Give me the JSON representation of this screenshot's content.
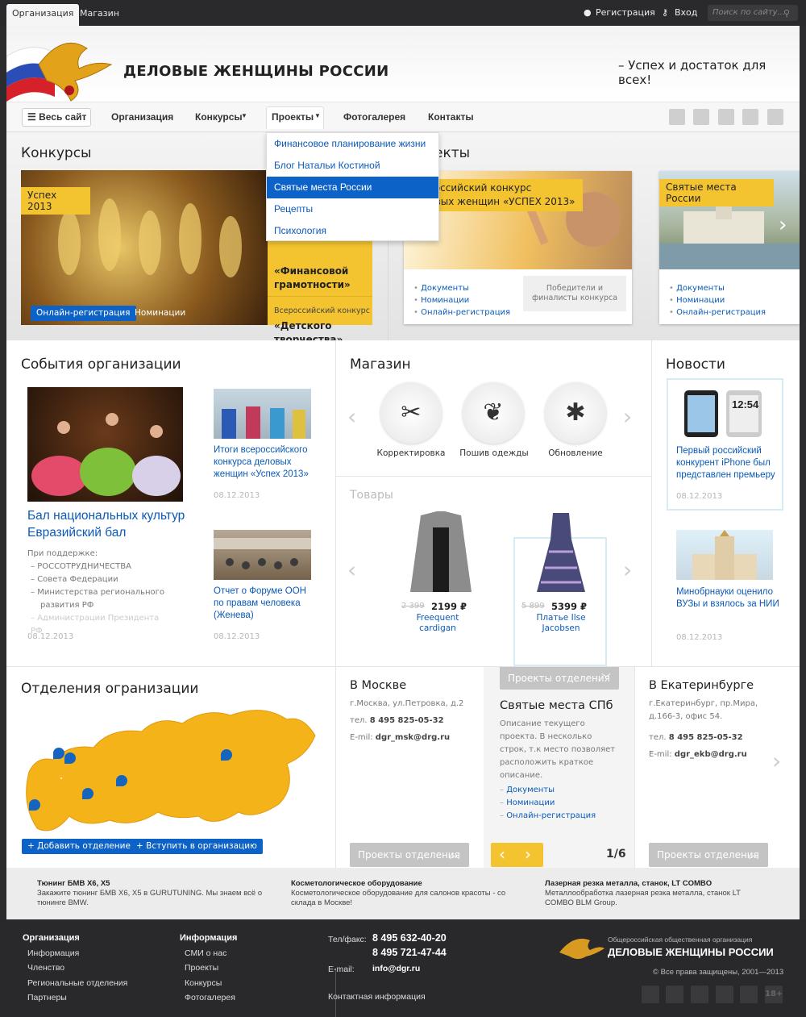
{
  "topbar": {
    "tabs": [
      "Организация",
      "Магазин"
    ],
    "register": "Регистрация",
    "login": "Вход",
    "search_placeholder": "Поиск по сайту..."
  },
  "header": {
    "title": "ДЕЛОВЫЕ ЖЕНЩИНЫ РОССИИ",
    "slogan": "– Успех и достаток для всех!"
  },
  "nav": {
    "all_site": "Весь сайт",
    "items": [
      "Организация",
      "Конкурсы",
      "Проекты",
      "Фотогалерея",
      "Контакты"
    ]
  },
  "dropdown": [
    "Финансовое планирование жизни",
    "Блог Натальи Костиной",
    "Святые места России",
    "Рецепты",
    "Психология"
  ],
  "competitions": {
    "heading": "Конкурсы",
    "heading2": "екты",
    "feature": {
      "label": "Успех 2013",
      "register_btn": "Онлайн-регистрация",
      "nominations": "Номинации"
    },
    "side": [
      {
        "title": "«Финансовой грамотности»"
      },
      {
        "pre": "Всероссийский конкурс",
        "title": "«Детского творчества»"
      }
    ],
    "project1": {
      "label": "Всероссийский конкурс деловых женщин «УСПЕХ 2013»",
      "links": [
        "Документы",
        "Номинации",
        "Онлайн-регистрация"
      ],
      "winners": "Победители и финалисты конкурса"
    },
    "project2": {
      "label": "Святые места России",
      "links": [
        "Документы",
        "Номинации",
        "Онлайн-регистрация"
      ]
    }
  },
  "events": {
    "heading": "События организации",
    "main_title": "Бал национальных культур Евразийский бал",
    "support_label": "При поддержке:",
    "support": [
      "РОССОТРУДНИЧЕСТВА",
      "Совета Федерации",
      "Министерства регионального развития РФ",
      "Администрации Президента РФ"
    ],
    "main_date": "08.12.2013",
    "items": [
      {
        "title": "Итоги всероссийского конкурса деловых женщин «Успех 2013»",
        "date": "08.12.2013"
      },
      {
        "title": "Отчет о Форуме ООН по правам человека (Женева)",
        "date": "08.12.2013"
      }
    ]
  },
  "shop": {
    "heading": "Магазин",
    "services": [
      {
        "icon": "scissors-icon",
        "label": "Корректировка"
      },
      {
        "icon": "leaf-icon",
        "label": "Пошив одежды"
      },
      {
        "icon": "asterisk-icon",
        "label": "Обновление"
      }
    ],
    "goods_heading": "Товары",
    "goods": [
      {
        "old": "2 399",
        "price": "2199 ₽",
        "name": "Freequent cardigan"
      },
      {
        "old": "5 899",
        "price": "5399 ₽",
        "name": "Платье Ilse Jacobsen"
      }
    ]
  },
  "news": {
    "heading": "Новости",
    "items": [
      {
        "title": "Первый российский конкурент iPhone был представлен премьеру",
        "date": "08.12.2013",
        "phone_time": "12:54"
      },
      {
        "title": "Минобрнауки оценило ВУЗы и взялось за НИИ",
        "date": "08.12.2013"
      }
    ]
  },
  "branches": {
    "heading": "Отделения огранизации",
    "add_btn": "Добавить отделение",
    "join_btn": "Вступить в организацию",
    "moscow": {
      "title": "В Москве",
      "address": "г.Москва, ул.Петровка, д.2",
      "phone_label": "тел.",
      "phone": "8 495 825-05-32",
      "email_label": "E-mil:",
      "email": "dgr_msk@drg.ru",
      "btn": "Проекты отделения"
    },
    "spb": {
      "tab": "Проекты отделения",
      "title": "Святые места СПб",
      "desc": "Описание текущего проекта. В несколько строк, т.к место позволяет расположить краткое описание.",
      "links": [
        "Документы",
        "Номинации",
        "Онлайн-регистрация"
      ],
      "pager": "1/6"
    },
    "ekb": {
      "title": "В Екатеринбурге",
      "address": "г.Екатеринбург, пр.Мира, д.166-3, офис 54.",
      "phone_label": "тел.",
      "phone": "8 495 825-05-32",
      "email_label": "E-mil:",
      "email": "dgr_ekb@drg.ru",
      "btn": "Проекты отделения"
    }
  },
  "ads": [
    {
      "title": "Тюнинг БМВ X6, X5",
      "text": "Закажите тюнинг БМВ X6, X5 в GURUTUNING. Мы знаем всё о тюнинге BMW."
    },
    {
      "title": "Косметологическое оборудование",
      "text": "Косметологическое оборудование для салонов красоты - со склада в Москве!"
    },
    {
      "title": "Лазерная резка металла, станок, LT COMBO",
      "text": "Металлообработка лазерная резка металла, станок LT COMBO BLM Group."
    }
  ],
  "footer": {
    "col1": {
      "heading": "Организация",
      "links": [
        "Информация",
        "Членство",
        "Региональные отделения",
        "Партнеры"
      ]
    },
    "col2": {
      "heading": "Информация",
      "links": [
        "СМИ о нас",
        "Проекты",
        "Конкурсы",
        "Фотогалерея"
      ]
    },
    "phone_label": "Тел/факс:",
    "phone1": "8 495 632-40-20",
    "phone2": "8 495 721-47-44",
    "email_label": "E-mail:",
    "email": "info@dgr.ru",
    "contacts": "Контактная информация",
    "org_sub": "Общероссийская общественная организация",
    "org_name": "ДЕЛОВЫЕ ЖЕНЩИНЫ РОССИИ",
    "copyright": "© Все права защищены, 2001—2013",
    "age": "18+"
  },
  "colors": {
    "accent_blue": "#0d62c7",
    "accent_yellow": "#f4c430"
  }
}
